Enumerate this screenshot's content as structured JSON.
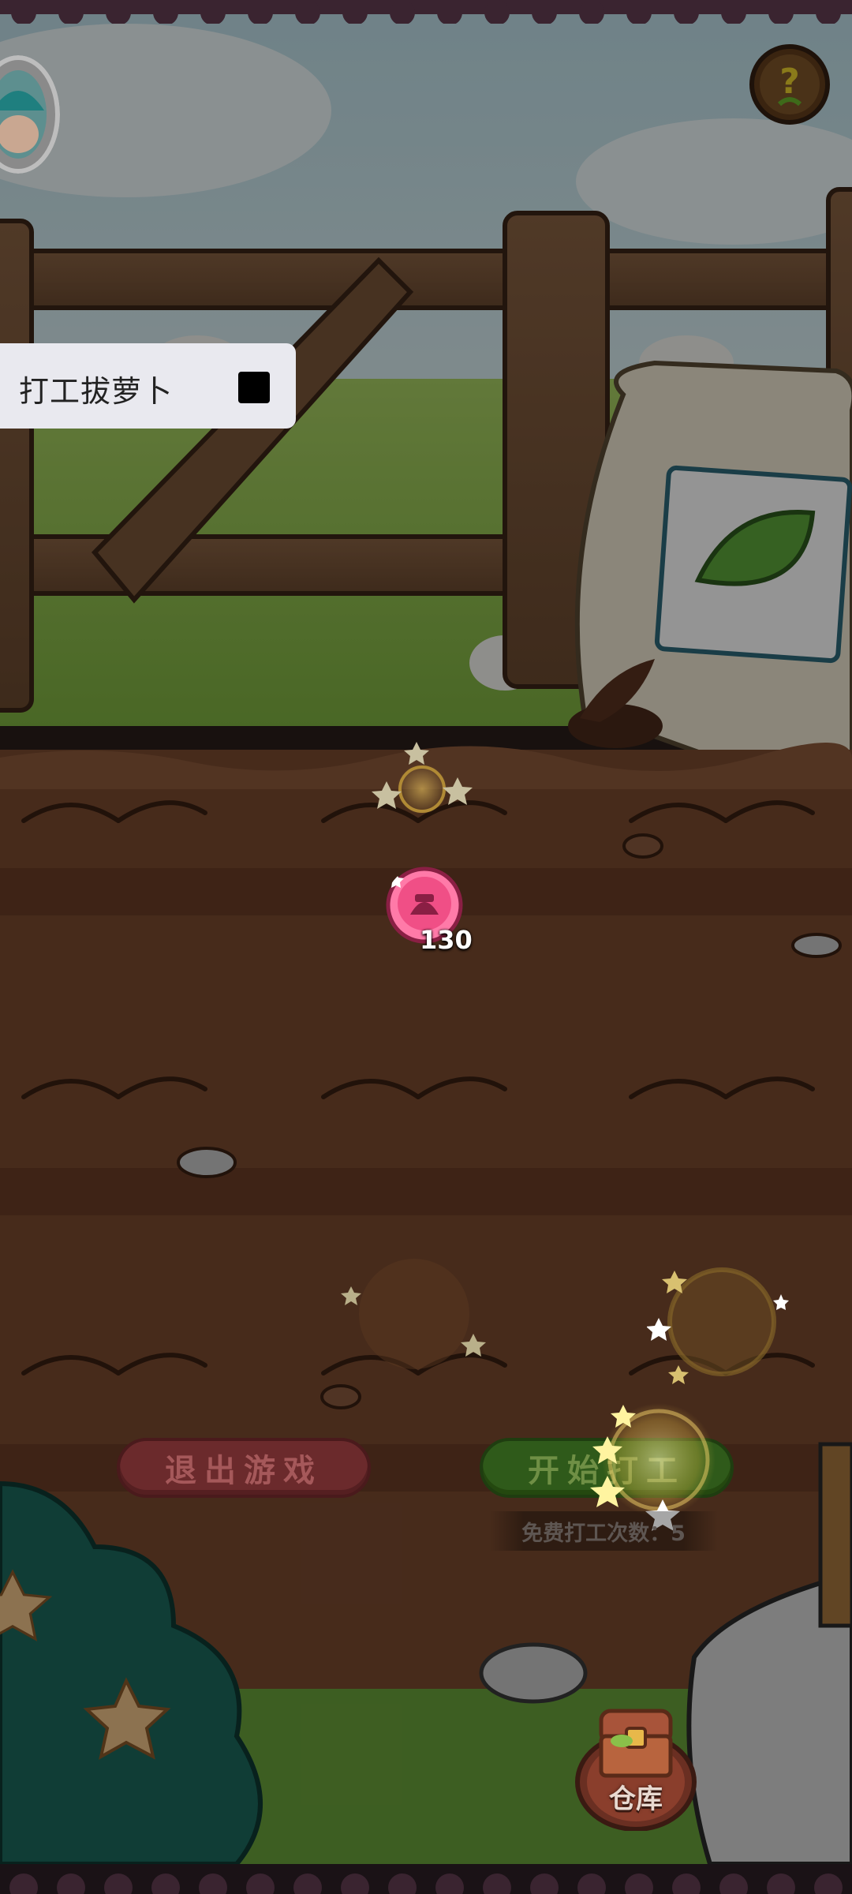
{
  "panel": {
    "label": "打工拔萝卜"
  },
  "coin": {
    "count": "130"
  },
  "buttons": {
    "exit_label": "退出游戏",
    "start_label": "开始打工"
  },
  "free_count": {
    "text": "免费打工次数：5"
  },
  "warehouse": {
    "label": "仓库"
  },
  "icons": {
    "help": "question-sprout-icon",
    "avatar": "player-avatar",
    "coin": "farmer-coin-icon",
    "warehouse": "treasure-chest-icon"
  },
  "colors": {
    "exit_button": "#6b2a2c",
    "start_button": "#2f5a1a",
    "soil": "#7a4a30",
    "grass": "#7fb241",
    "coin_pink": "#ff7aa8"
  }
}
